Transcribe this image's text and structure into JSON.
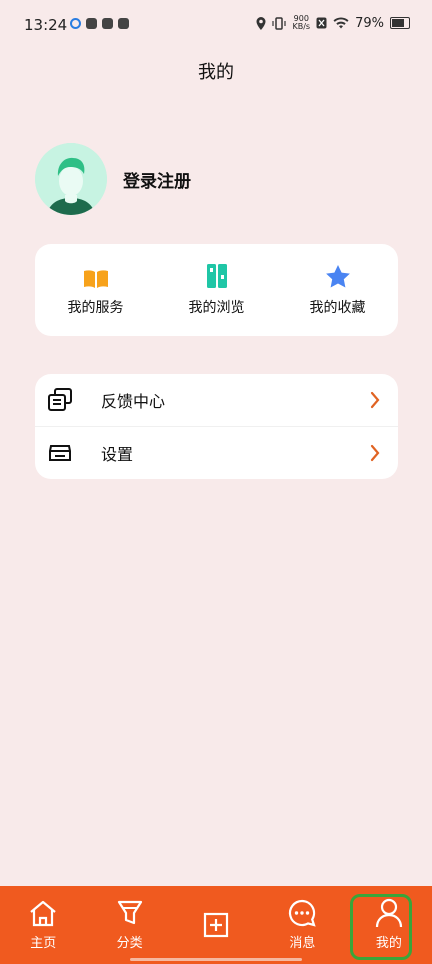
{
  "status_bar": {
    "time": "13:24",
    "net_speed_value": "900",
    "net_speed_unit": "KB/s",
    "battery": "79%"
  },
  "header": {
    "title": "我的"
  },
  "profile": {
    "login_label": "登录注册"
  },
  "shortcuts": [
    {
      "label": "我的服务",
      "icon": "book-icon"
    },
    {
      "label": "我的浏览",
      "icon": "browse-icon"
    },
    {
      "label": "我的收藏",
      "icon": "star-icon"
    }
  ],
  "menu": [
    {
      "label": "反馈中心",
      "icon": "feedback-icon"
    },
    {
      "label": "设置",
      "icon": "settings-icon"
    }
  ],
  "tabbar": [
    {
      "label": "主页",
      "icon": "home-icon"
    },
    {
      "label": "分类",
      "icon": "category-icon"
    },
    {
      "label": "",
      "icon": "add-icon"
    },
    {
      "label": "消息",
      "icon": "message-icon"
    },
    {
      "label": "我的",
      "icon": "user-icon",
      "active": true
    }
  ],
  "colors": {
    "accent": "#f05a1f",
    "background": "#f8eaea",
    "card": "#ffffff",
    "active_outline": "#3aa53a"
  }
}
